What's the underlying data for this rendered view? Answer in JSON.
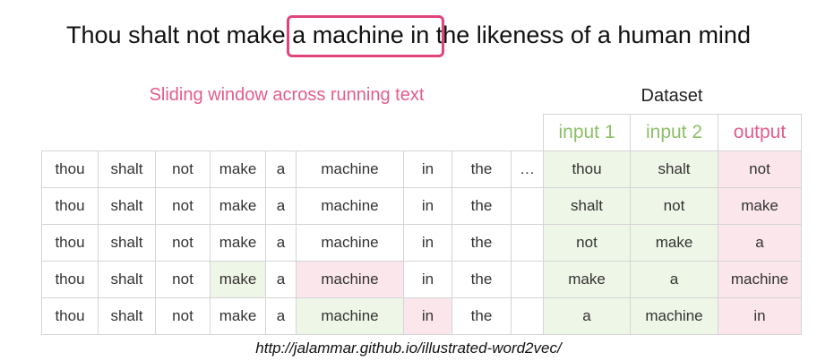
{
  "sentence": {
    "before": "Thou shalt not make ",
    "window": "a machine in",
    "after": " the likeness of a human mind"
  },
  "left_caption": "Sliding window across running text",
  "right_caption": "Dataset",
  "running_rows": [
    [
      "thou",
      "shalt",
      "not",
      "make",
      "a",
      "machine",
      "in",
      "the",
      "…"
    ],
    [
      "thou",
      "shalt",
      "not",
      "make",
      "a",
      "machine",
      "in",
      "the",
      ""
    ],
    [
      "thou",
      "shalt",
      "not",
      "make",
      "a",
      "machine",
      "in",
      "the",
      ""
    ],
    [
      "thou",
      "shalt",
      "not",
      "make",
      "a",
      "machine",
      "in",
      "the",
      ""
    ],
    [
      "thou",
      "shalt",
      "not",
      "make",
      "a",
      "machine",
      "in",
      "the",
      ""
    ]
  ],
  "dataset": {
    "headers": [
      "input 1",
      "input 2",
      "output"
    ],
    "rows": [
      [
        "thou",
        "shalt",
        "not"
      ],
      [
        "shalt",
        "not",
        "make"
      ],
      [
        "not",
        "make",
        "a"
      ],
      [
        "make",
        "a",
        "machine"
      ],
      [
        "a",
        "machine",
        "in"
      ]
    ]
  },
  "url": "http://jalammar.github.io/illustrated-word2vec/",
  "colors": {
    "window_border": "#e0447c",
    "input_green": "#eef6e7",
    "output_pink": "#fbe6ec",
    "caption_pink": "#e45c8c",
    "header_green": "#8cc068"
  }
}
